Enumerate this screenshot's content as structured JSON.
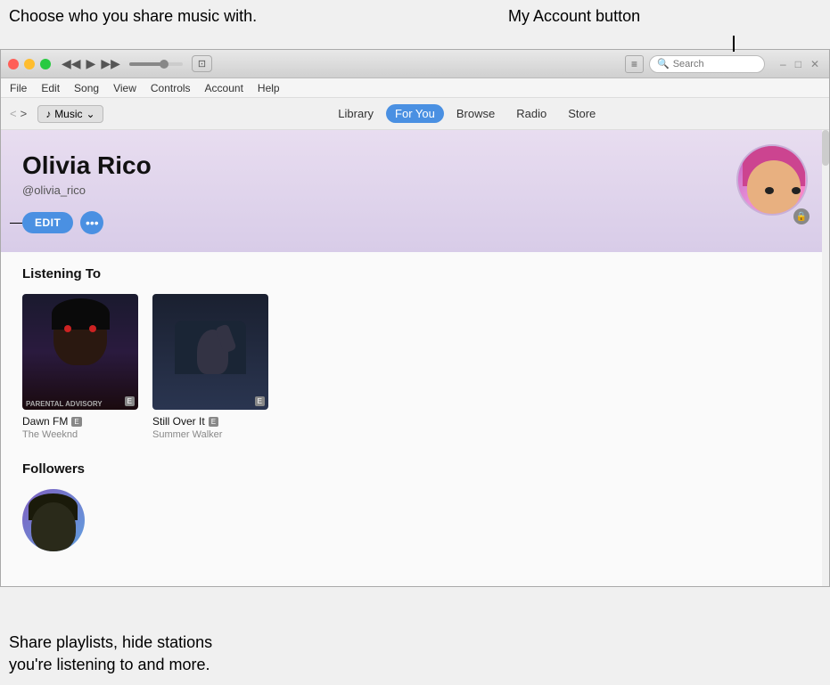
{
  "annotations": {
    "top_left": "Choose who you share music with.",
    "top_right": "My Account button",
    "bottom_left": "Share playlists, hide stations\nyou're listening to and more."
  },
  "titlebar": {
    "transport": {
      "back": "◀◀",
      "play": "▶",
      "forward": "▶▶"
    },
    "apple_logo": "",
    "search_placeholder": "Search",
    "list_btn": "≡",
    "win_btns": [
      "–",
      "□",
      "✕"
    ]
  },
  "menubar": {
    "items": [
      "File",
      "Edit",
      "Song",
      "View",
      "Controls",
      "Account",
      "Help"
    ]
  },
  "navbar": {
    "back": "<",
    "forward": ">",
    "source_icon": "♪",
    "source_label": "Music",
    "tabs": [
      {
        "label": "Library",
        "active": false
      },
      {
        "label": "For You",
        "active": true
      },
      {
        "label": "Browse",
        "active": false
      },
      {
        "label": "Radio",
        "active": false
      },
      {
        "label": "Store",
        "active": false
      }
    ]
  },
  "profile": {
    "name": "Olivia Rico",
    "handle": "@olivia_rico",
    "edit_btn": "EDIT",
    "more_btn": "•••"
  },
  "listening_to": {
    "section_title": "Listening To",
    "albums": [
      {
        "title": "Dawn FM",
        "artist": "The Weeknd",
        "explicit": "E"
      },
      {
        "title": "Still Over It",
        "artist": "Summer Walker",
        "explicit": "E"
      }
    ]
  },
  "followers": {
    "section_title": "Followers"
  },
  "icons": {
    "search": "🔍",
    "music_note": "♪",
    "lock": "🔒",
    "explicit": "E",
    "airplay": "⬛"
  }
}
